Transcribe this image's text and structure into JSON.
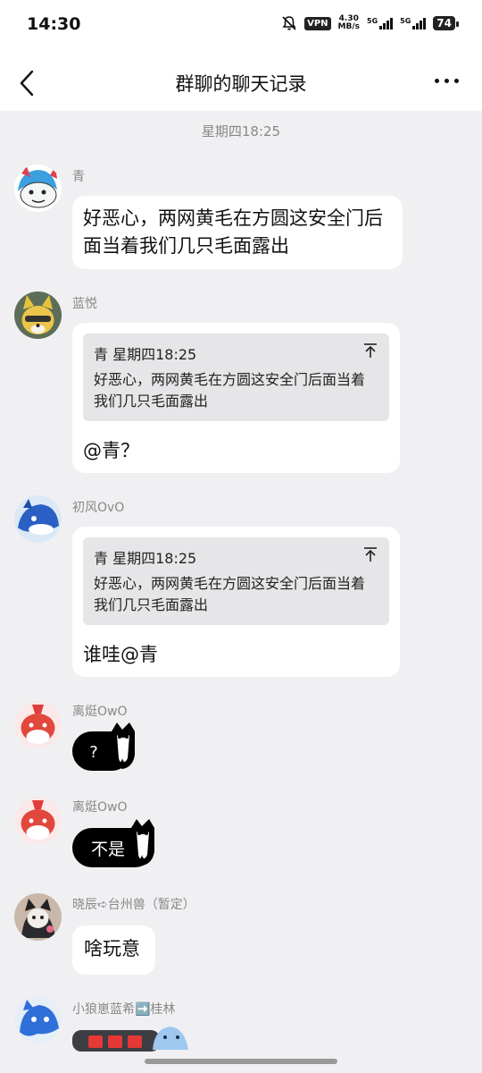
{
  "status_bar": {
    "time": "14:30",
    "vpn_label": "VPN",
    "speed_value": "4.30",
    "speed_unit": "MB/s",
    "net1": "5G",
    "net2": "5G",
    "battery": "74"
  },
  "header": {
    "title": "群聊的聊天记录"
  },
  "timestamp": "星期四18:25",
  "messages": [
    {
      "sender": "青",
      "text": "好恶心，两网黄毛在方圆这安全门后面当着我们几只毛面露出"
    },
    {
      "sender": "蓝悦",
      "quote": {
        "sender": "青",
        "time": "星期四18:25",
        "text": "好恶心，两网黄毛在方圆这安全门后面当着我们几只毛面露出"
      },
      "text": "@青？"
    },
    {
      "sender": "初风OvO",
      "quote": {
        "sender": "青",
        "time": "星期四18:25",
        "text": "好恶心，两网黄毛在方圆这安全门后面当着我们几只毛面露出"
      },
      "text": "谁哇@青"
    },
    {
      "sender": "离烶OwO",
      "sticker_text": "?"
    },
    {
      "sender": "离烶OwO",
      "sticker_text": "不是"
    },
    {
      "sender": "晓辰➪台州兽（暂定）",
      "text": "啥玩意"
    },
    {
      "sender": "小狼崽蓝希➡️桂林"
    }
  ],
  "colors": {
    "background": "#f0f0f3",
    "bubble": "#ffffff",
    "quote": "#e6e6e8",
    "meta": "#888888"
  }
}
